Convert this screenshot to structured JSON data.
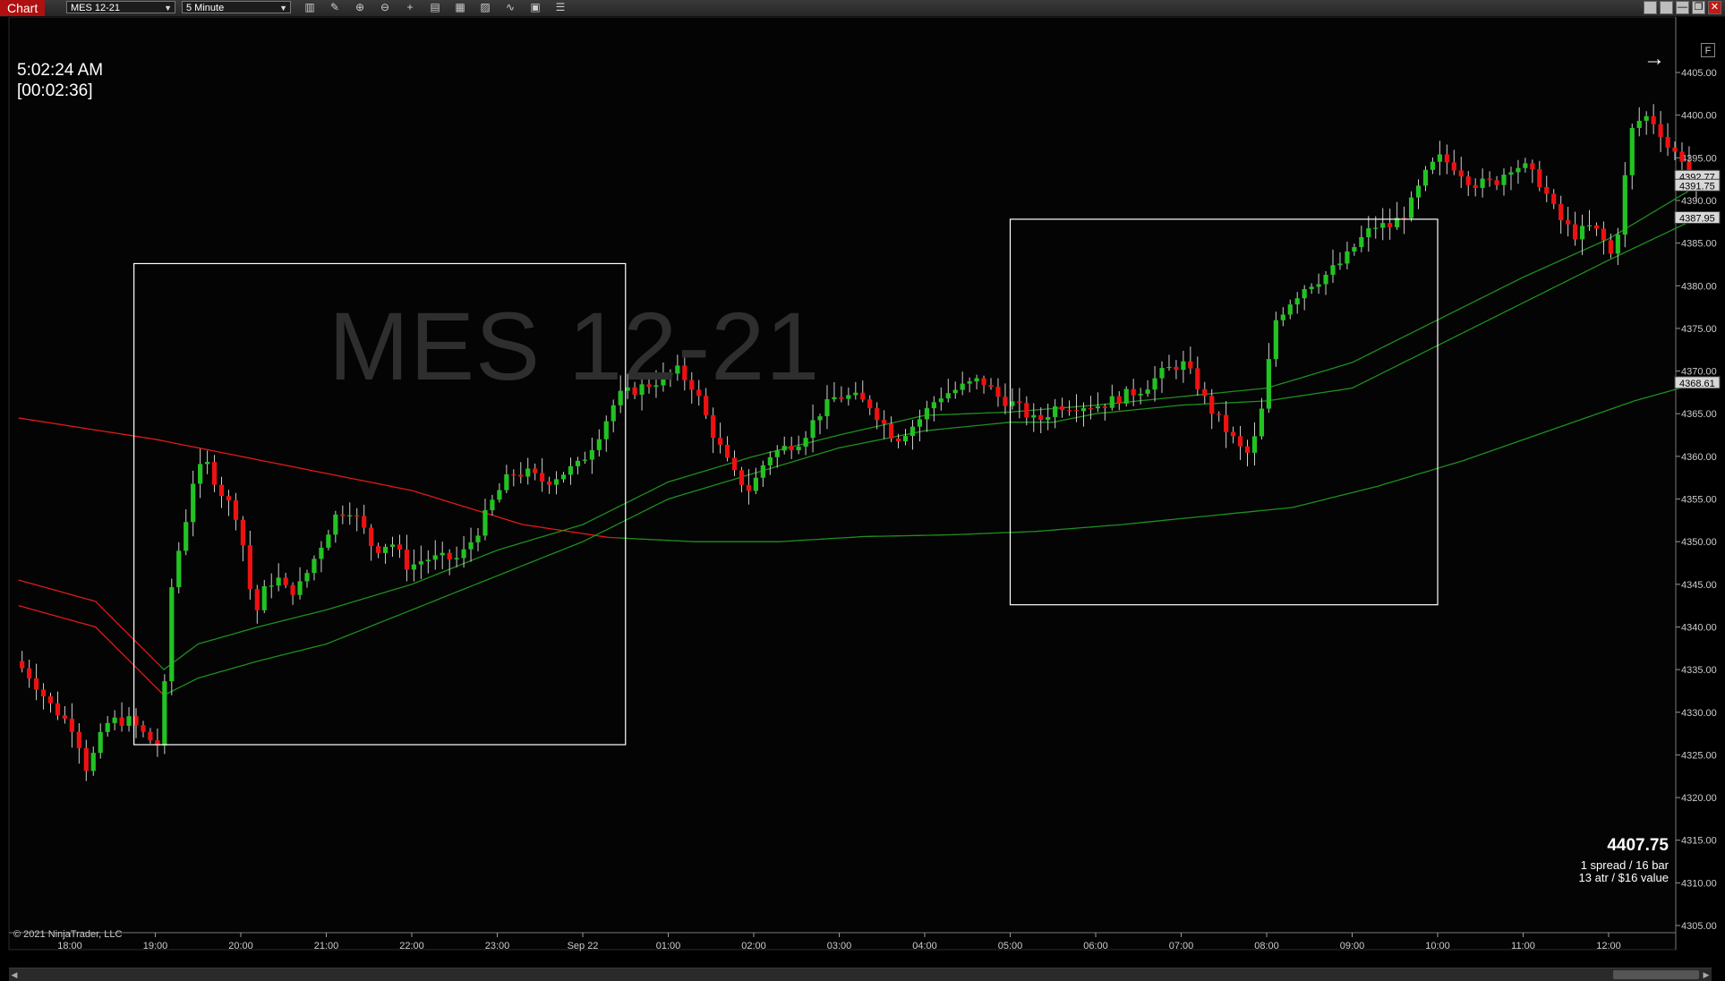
{
  "toolbar": {
    "tab_label": "Chart",
    "instrument": "MES 12-21",
    "interval": "5 Minute",
    "tools": [
      {
        "name": "bars-type-icon",
        "glyph": "▥"
      },
      {
        "name": "drawing-tool-icon",
        "glyph": "✎"
      },
      {
        "name": "zoom-in-icon",
        "glyph": "⊕"
      },
      {
        "name": "zoom-out-icon",
        "glyph": "⊖"
      },
      {
        "name": "crosshair-icon",
        "glyph": "+"
      },
      {
        "name": "properties-icon",
        "glyph": "▤"
      },
      {
        "name": "templates-icon",
        "glyph": "▦"
      },
      {
        "name": "indicators-icon",
        "glyph": "▨"
      },
      {
        "name": "strategies-icon",
        "glyph": "∿"
      },
      {
        "name": "data-box-icon",
        "glyph": "▣"
      },
      {
        "name": "list-icon",
        "glyph": "☰"
      }
    ],
    "window_buttons": [
      "",
      "",
      "—",
      "❐",
      "✕"
    ]
  },
  "chart": {
    "clock_time": "5:02:24 AM",
    "bar_remaining": "[00:02:36]",
    "watermark": "MES 12-21",
    "copyright": "© 2021 NinjaTrader, LLC",
    "info_price": "4407.75",
    "info_line1": "1 spread / 16 bar",
    "info_line2": "13 atr / $16 value",
    "f_label": "F",
    "colors": {
      "up": "#22c222",
      "down": "#ee1111",
      "ma_red": "#e01a1a",
      "ma_green": "#1e8f1e",
      "box": "#ffffff"
    }
  },
  "chart_data": {
    "type": "candlestick",
    "y_axis": {
      "min": 4305,
      "max": 4405,
      "step": 5,
      "tick_labels": [
        "4305.00",
        "4310.00",
        "4315.00",
        "4320.00",
        "4325.00",
        "4330.00",
        "4335.00",
        "4340.00",
        "4345.00",
        "4350.00",
        "4355.00",
        "4360.00",
        "4365.00",
        "4370.00",
        "4375.00",
        "4380.00",
        "4385.00",
        "4390.00",
        "4395.00",
        "4400.00",
        "4405.00"
      ],
      "price_markers": [
        {
          "label": "4392.77",
          "value": 4392.8
        },
        {
          "label": "4391.75",
          "value": 4391.75
        },
        {
          "label": "4387.95",
          "value": 4387.95
        },
        {
          "label": "4368.61",
          "value": 4368.61
        }
      ]
    },
    "x_axis": {
      "tick_labels": [
        "18:00",
        "19:00",
        "20:00",
        "21:00",
        "22:00",
        "23:00",
        "Sep 22",
        "01:00",
        "02:00",
        "03:00",
        "04:00",
        "05:00",
        "06:00",
        "07:00",
        "08:00",
        "09:00",
        "10:00",
        "11:00",
        "12:00"
      ],
      "tick_hours": [
        0,
        1,
        2,
        3,
        4,
        5,
        6,
        7,
        8,
        9,
        10,
        11,
        12,
        13,
        14,
        15,
        16,
        17,
        18
      ],
      "start_hour": -0.6,
      "end_hour": 19.05
    },
    "price_path": [
      [
        -0.6,
        4336
      ],
      [
        -0.4,
        4334
      ],
      [
        -0.2,
        4331
      ],
      [
        0.1,
        4328
      ],
      [
        0.25,
        4323
      ],
      [
        0.35,
        4326
      ],
      [
        0.5,
        4329
      ],
      [
        0.75,
        4329
      ],
      [
        0.95,
        4327
      ],
      [
        1.1,
        4326
      ],
      [
        1.15,
        4333
      ],
      [
        1.25,
        4347
      ],
      [
        1.35,
        4350
      ],
      [
        1.5,
        4358
      ],
      [
        1.65,
        4359
      ],
      [
        1.8,
        4356
      ],
      [
        2.0,
        4353
      ],
      [
        2.1,
        4348
      ],
      [
        2.2,
        4341
      ],
      [
        2.3,
        4344
      ],
      [
        2.45,
        4346
      ],
      [
        2.6,
        4344
      ],
      [
        2.75,
        4345
      ],
      [
        2.95,
        4349
      ],
      [
        3.15,
        4353
      ],
      [
        3.3,
        4354
      ],
      [
        3.45,
        4352
      ],
      [
        3.6,
        4349
      ],
      [
        3.8,
        4350
      ],
      [
        4.0,
        4347
      ],
      [
        4.2,
        4348
      ],
      [
        4.4,
        4348
      ],
      [
        4.6,
        4348
      ],
      [
        4.8,
        4351
      ],
      [
        5.0,
        4355
      ],
      [
        5.2,
        4358
      ],
      [
        5.4,
        4358
      ],
      [
        5.6,
        4357
      ],
      [
        5.8,
        4358
      ],
      [
        6.0,
        4359
      ],
      [
        6.2,
        4362
      ],
      [
        6.45,
        4367
      ],
      [
        6.7,
        4368
      ],
      [
        6.95,
        4369
      ],
      [
        7.15,
        4370
      ],
      [
        7.35,
        4368
      ],
      [
        7.55,
        4363
      ],
      [
        7.8,
        4358
      ],
      [
        8.0,
        4356
      ],
      [
        8.2,
        4360
      ],
      [
        8.4,
        4361
      ],
      [
        8.6,
        4362
      ],
      [
        8.8,
        4365
      ],
      [
        9.0,
        4367
      ],
      [
        9.2,
        4367
      ],
      [
        9.4,
        4366
      ],
      [
        9.55,
        4364
      ],
      [
        9.7,
        4362
      ],
      [
        9.95,
        4364
      ],
      [
        10.2,
        4367
      ],
      [
        10.45,
        4368
      ],
      [
        10.7,
        4369
      ],
      [
        10.9,
        4367
      ],
      [
        11.1,
        4366
      ],
      [
        11.35,
        4364
      ],
      [
        11.6,
        4366
      ],
      [
        11.85,
        4366
      ],
      [
        12.1,
        4366
      ],
      [
        12.35,
        4367
      ],
      [
        12.6,
        4368
      ],
      [
        12.85,
        4370
      ],
      [
        13.05,
        4371
      ],
      [
        13.2,
        4369
      ],
      [
        13.35,
        4366
      ],
      [
        13.5,
        4364
      ],
      [
        13.65,
        4362
      ],
      [
        13.8,
        4360
      ],
      [
        13.95,
        4363
      ],
      [
        14.05,
        4370
      ],
      [
        14.15,
        4376
      ],
      [
        14.3,
        4378
      ],
      [
        14.5,
        4380
      ],
      [
        14.7,
        4381
      ],
      [
        14.95,
        4383
      ],
      [
        15.1,
        4385
      ],
      [
        15.3,
        4387
      ],
      [
        15.5,
        4387
      ],
      [
        15.7,
        4389
      ],
      [
        15.9,
        4393
      ],
      [
        16.05,
        4395
      ],
      [
        16.25,
        4394
      ],
      [
        16.45,
        4392
      ],
      [
        16.7,
        4392
      ],
      [
        16.9,
        4394
      ],
      [
        17.05,
        4394
      ],
      [
        17.25,
        4392
      ],
      [
        17.45,
        4388
      ],
      [
        17.65,
        4386
      ],
      [
        17.85,
        4387
      ],
      [
        18.0,
        4385
      ],
      [
        18.1,
        4383
      ],
      [
        18.2,
        4390
      ],
      [
        18.3,
        4398
      ],
      [
        18.45,
        4400
      ],
      [
        18.6,
        4399
      ],
      [
        18.75,
        4396
      ],
      [
        18.9,
        4395
      ],
      [
        19.05,
        4391
      ]
    ],
    "ma_lines": [
      {
        "color": "red_green",
        "points": [
          [
            -0.6,
            4364.5
          ],
          [
            1.0,
            4362
          ],
          [
            2.5,
            4359
          ],
          [
            4.0,
            4356
          ],
          [
            5.3,
            4352
          ],
          [
            6.3,
            4350.5
          ],
          [
            7.3,
            4350
          ],
          [
            8.3,
            4350
          ],
          [
            9.3,
            4350.6
          ],
          [
            10.3,
            4350.8
          ],
          [
            11.3,
            4351.2
          ],
          [
            12.3,
            4352
          ],
          [
            13.3,
            4353
          ],
          [
            14.3,
            4354
          ],
          [
            15.3,
            4356.5
          ],
          [
            16.3,
            4359.5
          ],
          [
            17.3,
            4363
          ],
          [
            18.3,
            4366.5
          ],
          [
            19.05,
            4368.6
          ]
        ],
        "switch_hour": 6.4
      },
      {
        "color": "red_green",
        "points": [
          [
            -0.6,
            4345.5
          ],
          [
            0.3,
            4343
          ],
          [
            0.7,
            4339
          ],
          [
            1.1,
            4335
          ],
          [
            1.5,
            4338
          ],
          [
            2.2,
            4340
          ],
          [
            3.0,
            4342
          ],
          [
            4.0,
            4345
          ],
          [
            5.0,
            4349
          ],
          [
            6.0,
            4352
          ],
          [
            7.0,
            4357
          ],
          [
            8.0,
            4360
          ],
          [
            9.0,
            4362.5
          ],
          [
            10.0,
            4364.8
          ],
          [
            11.0,
            4365.2
          ],
          [
            12.0,
            4366
          ],
          [
            13.0,
            4367
          ],
          [
            14.0,
            4368
          ],
          [
            15.0,
            4371
          ],
          [
            16.0,
            4376
          ],
          [
            17.0,
            4381
          ],
          [
            18.0,
            4385.5
          ],
          [
            19.05,
            4391.8
          ]
        ],
        "switch_hour": 1.1
      },
      {
        "color": "red_green",
        "points": [
          [
            -0.6,
            4342.5
          ],
          [
            0.3,
            4340
          ],
          [
            0.7,
            4336
          ],
          [
            1.1,
            4332
          ],
          [
            1.5,
            4334
          ],
          [
            2.2,
            4336
          ],
          [
            3.0,
            4338
          ],
          [
            4.0,
            4342
          ],
          [
            5.0,
            4346
          ],
          [
            6.0,
            4350
          ],
          [
            7.0,
            4355
          ],
          [
            8.0,
            4358
          ],
          [
            9.0,
            4361
          ],
          [
            10.0,
            4363
          ],
          [
            11.0,
            4364
          ],
          [
            11.5,
            4364
          ],
          [
            12.0,
            4365
          ],
          [
            13.0,
            4366
          ],
          [
            14.0,
            4366.5
          ],
          [
            15.0,
            4368
          ],
          [
            16.0,
            4373
          ],
          [
            17.0,
            4378
          ],
          [
            18.0,
            4383
          ],
          [
            19.05,
            4388
          ]
        ],
        "switch_hour": 1.15
      }
    ],
    "boxes": [
      {
        "name": "left-rectangle",
        "x1": 0.75,
        "x2": 6.5,
        "y1": 4326.2,
        "y2": 4382.6
      },
      {
        "name": "right-rectangle",
        "x1": 11.0,
        "x2": 16.0,
        "y1": 4342.6,
        "y2": 4387.8
      }
    ]
  }
}
